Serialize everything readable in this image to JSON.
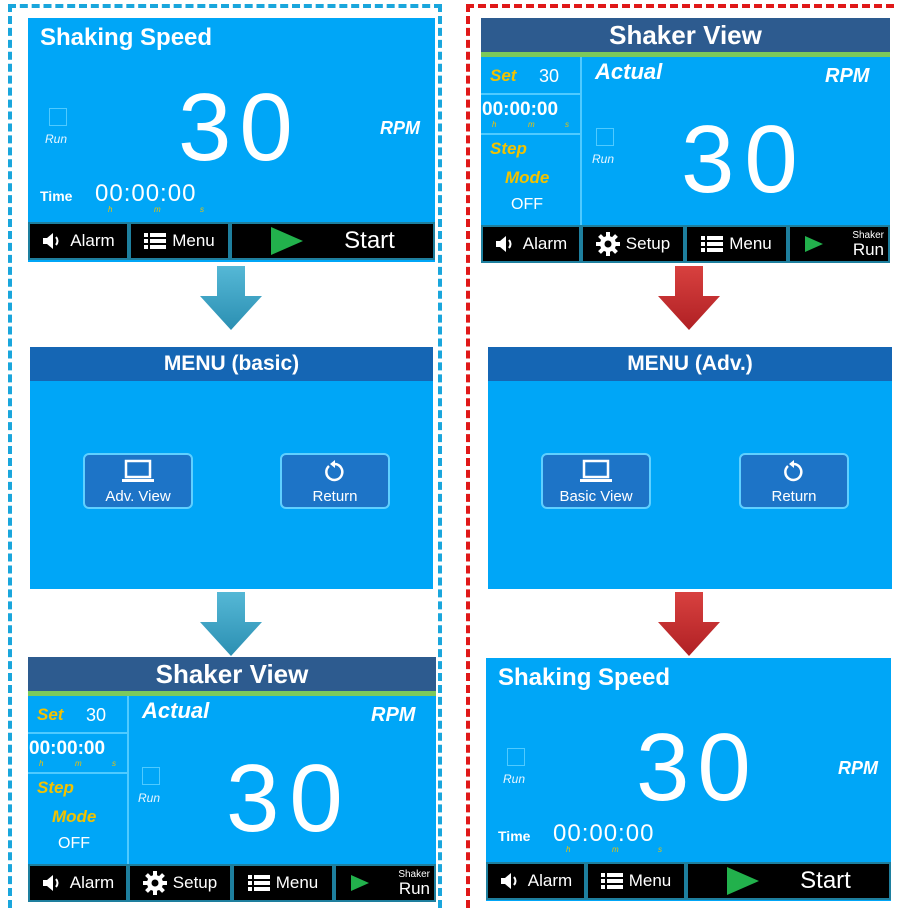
{
  "colors": {
    "panel_blue": "#00a6f7",
    "left_border": "#1aa6dc",
    "right_border": "#e01818",
    "label_yellow": "#f2c200",
    "start_green": "#22b14c",
    "arrow_blue": "#3aa4c4",
    "arrow_red": "#c8282c"
  },
  "basic_top": {
    "title": "Shaking Speed",
    "speed": "30",
    "rpm": "RPM",
    "run": "Run",
    "time_label": "Time",
    "time_value": "00:00:00",
    "h": "h",
    "m": "m",
    "s": "s",
    "alarm": "Alarm",
    "menu": "Menu",
    "start": "Start"
  },
  "menu_basic": {
    "title": "MENU (basic)",
    "adv_view": "Adv. View",
    "return": "Return"
  },
  "adv_bottom": {
    "title": "Shaker View",
    "set_label": "Set",
    "set_value": "30",
    "time_value": "00:00:00",
    "h": "h",
    "m": "m",
    "s": "s",
    "step_label": "Step",
    "mode_label": "Mode",
    "mode_value": "OFF",
    "actual": "Actual",
    "rpm": "RPM",
    "speed": "30",
    "run": "Run",
    "alarm": "Alarm",
    "setup": "Setup",
    "menu": "Menu",
    "shaker": "Shaker",
    "run_btn": "Run"
  },
  "adv_top": {
    "title": "Shaker View",
    "set_label": "Set",
    "set_value": "30",
    "time_value": "00:00:00",
    "h": "h",
    "m": "m",
    "s": "s",
    "step_label": "Step",
    "mode_label": "Mode",
    "mode_value": "OFF",
    "actual": "Actual",
    "rpm": "RPM",
    "speed": "30",
    "run": "Run",
    "alarm": "Alarm",
    "setup": "Setup",
    "menu": "Menu",
    "shaker": "Shaker",
    "run_btn": "Run"
  },
  "menu_adv": {
    "title": "MENU (Adv.)",
    "basic_view": "Basic View",
    "return": "Return"
  },
  "basic_bottom": {
    "title": "Shaking Speed",
    "speed": "30",
    "rpm": "RPM",
    "run": "Run",
    "time_label": "Time",
    "time_value": "00:00:00",
    "h": "h",
    "m": "m",
    "s": "s",
    "alarm": "Alarm",
    "menu": "Menu",
    "start": "Start"
  }
}
